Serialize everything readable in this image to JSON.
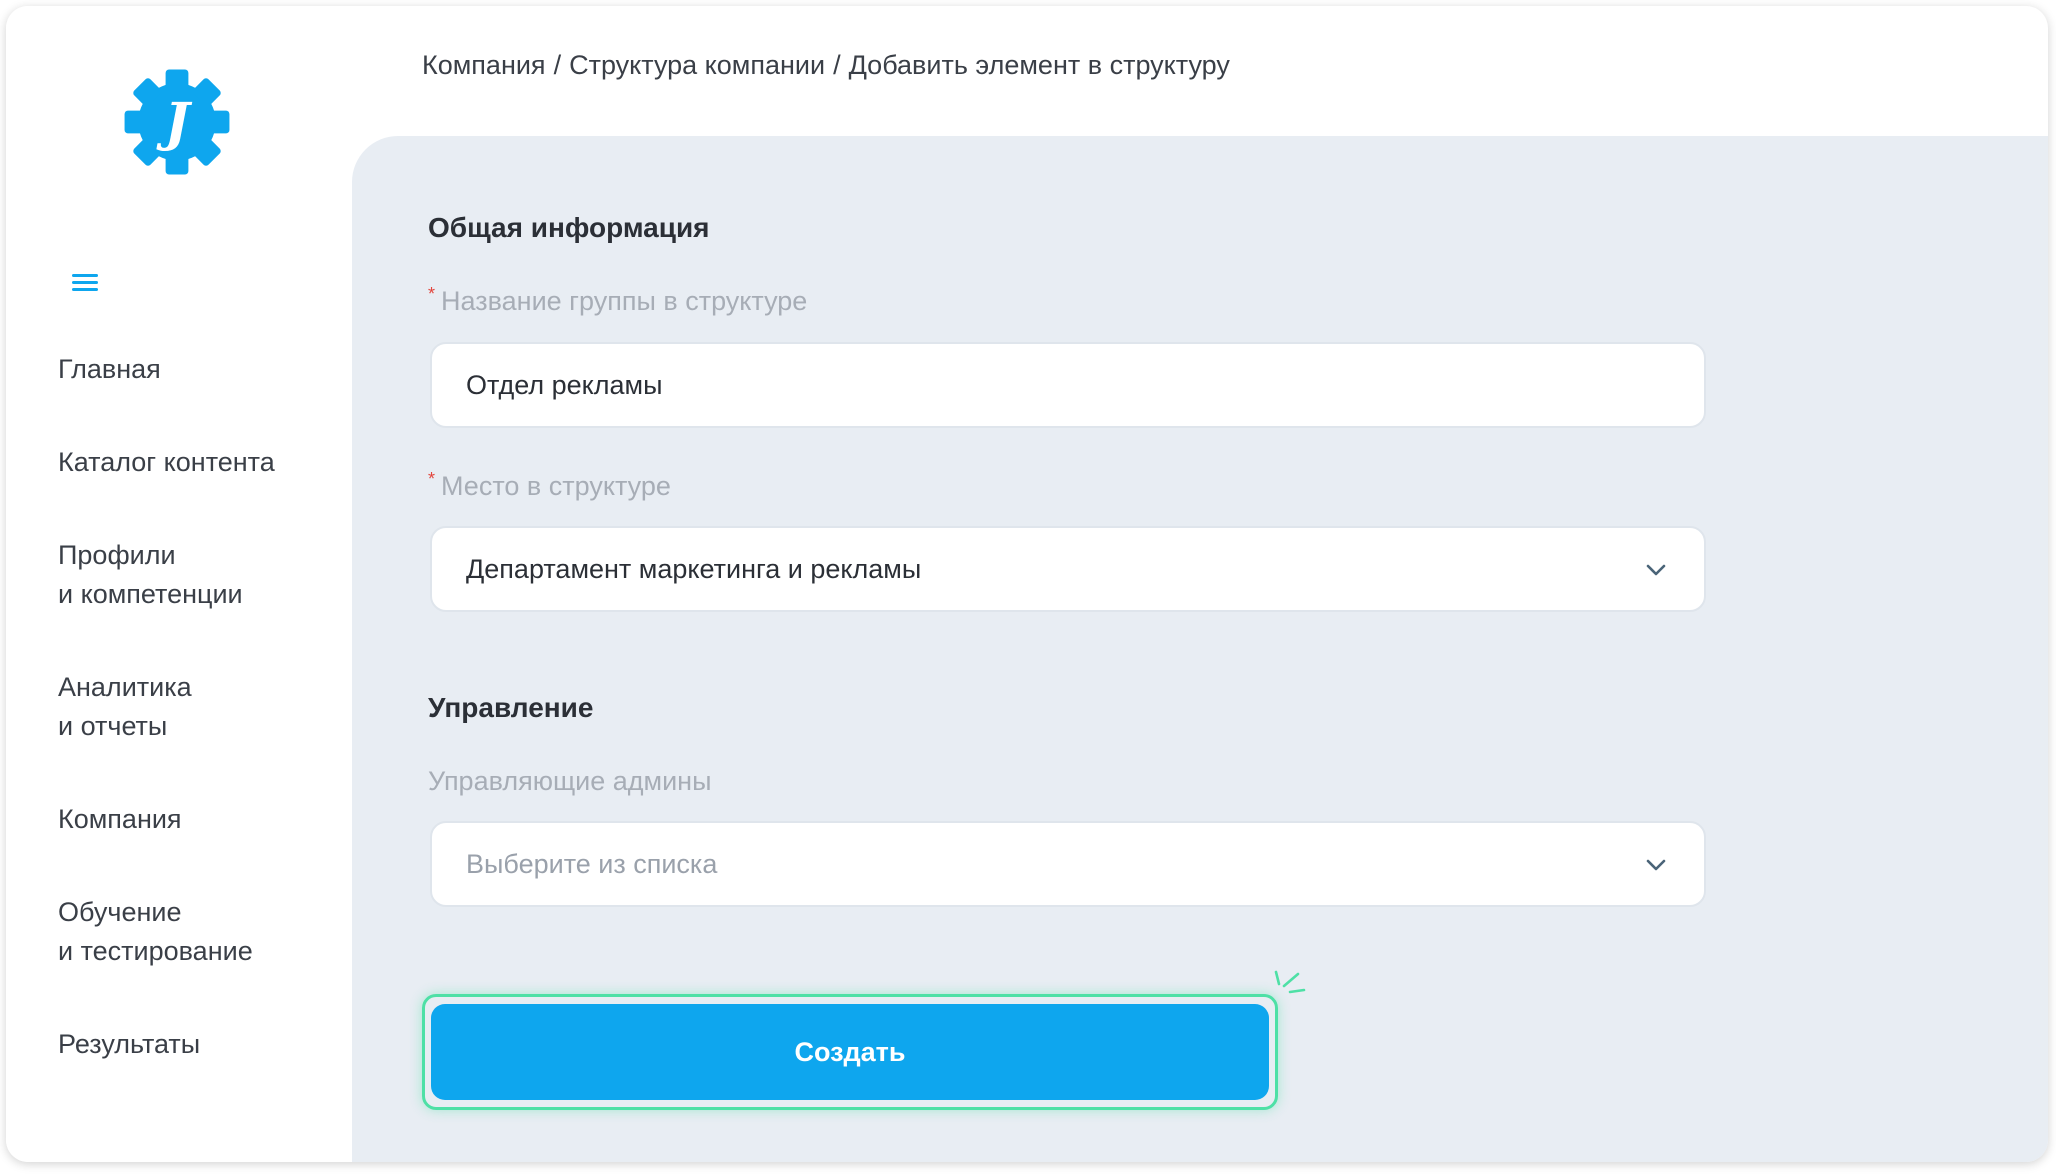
{
  "app": {
    "logo_letter": "J",
    "accent_color": "#0ea6ee",
    "highlight_color": "#4ee0a6"
  },
  "breadcrumb": {
    "items": [
      "Компания",
      "Структура компании",
      "Добавить элемент в структуру"
    ],
    "separator": "/"
  },
  "sidebar": {
    "items": [
      {
        "label": "Главная"
      },
      {
        "label": "Каталог контента"
      },
      {
        "label": "Профили\nи компетенции"
      },
      {
        "label": "Аналитика\nи отчеты"
      },
      {
        "label": "Компания"
      },
      {
        "label": "Обучение\nи тестирование"
      },
      {
        "label": "Результаты"
      }
    ]
  },
  "form": {
    "general": {
      "title": "Общая информация",
      "group_name": {
        "label": "Название группы в структуре",
        "required_mark": "*",
        "value": "Отдел рекламы"
      },
      "place": {
        "label": "Место в структуре",
        "required_mark": "*",
        "value": "Департамент маркетинга и рекламы"
      }
    },
    "management": {
      "title": "Управление",
      "admins": {
        "label": "Управляющие админы",
        "placeholder": "Выберите из списка"
      }
    },
    "submit_label": "Создать"
  }
}
